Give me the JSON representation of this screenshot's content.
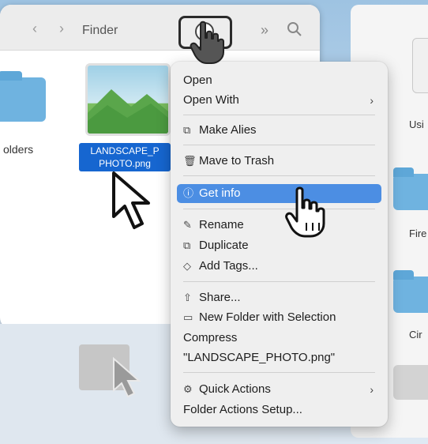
{
  "finder": {
    "title": "Finder",
    "back_icon": "chevron-left-icon",
    "forward_icon": "chevron-right-icon",
    "more_glyph": "»",
    "search_icon": "search-icon",
    "left_folder_label": "olders",
    "file": {
      "name_line1": "LANDSCAPE_P",
      "name_line2": "PHOTO.png"
    }
  },
  "right_pane": {
    "label_1": "Usi",
    "label_2": "Fire",
    "label_3": "Cir"
  },
  "context_menu": {
    "items": [
      {
        "label": "Open"
      },
      {
        "label": "Open With",
        "chevron": "›"
      },
      {
        "label": "Make Alies",
        "icon": "alias-icon"
      },
      {
        "label": "Mave to Trash",
        "icon": "trash-icon"
      },
      {
        "label": "Get info",
        "icon": "info-icon",
        "highlighted": true
      },
      {
        "label": "Rename",
        "icon": "pencil-icon"
      },
      {
        "label": "Duplicate",
        "icon": "duplicate-icon"
      },
      {
        "label": "Add Tags...",
        "icon": "tag-icon"
      },
      {
        "label": "Share...",
        "icon": "share-icon"
      },
      {
        "label": "New Folder with Selection",
        "icon": "folder-icon"
      },
      {
        "label": "Compress"
      },
      {
        "label": "\"LANDSCAPE_PHOTO.png\""
      },
      {
        "label": "Quick Actions",
        "icon": "gear-icon",
        "chevron": "›"
      },
      {
        "label": "Folder Actions Setup..."
      }
    ]
  },
  "colors": {
    "highlight": "#4c8ee3",
    "selection": "#1666d0",
    "folder": "#6fb3e0"
  }
}
